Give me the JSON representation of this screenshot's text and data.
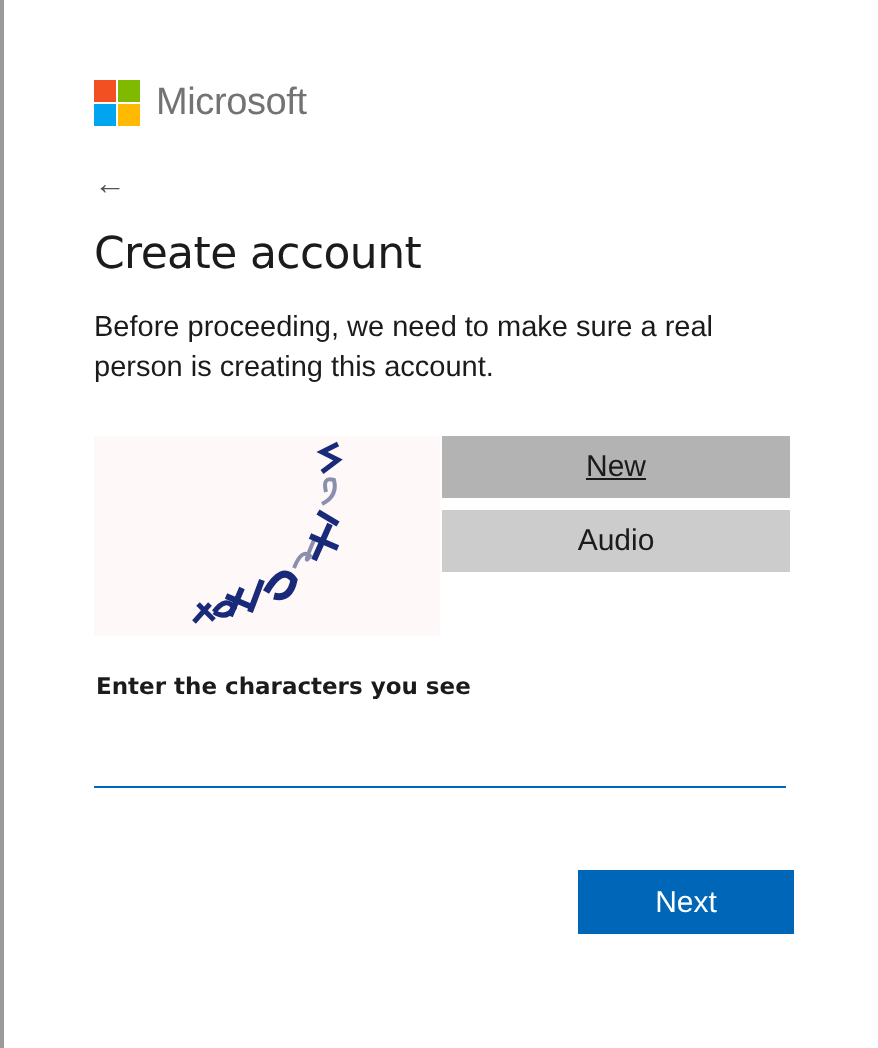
{
  "brand": {
    "name": "Microsoft"
  },
  "back": {
    "icon": "←"
  },
  "title": "Create account",
  "description": "Before proceeding, we need to make sure a real person is creating this account.",
  "captcha": {
    "kind": "picture",
    "buttons": [
      {
        "label": "New",
        "focused": true
      },
      {
        "label": "Audio",
        "focused": false
      }
    ]
  },
  "field": {
    "label": "Enter the characters you see"
  },
  "primary_button": {
    "label": "Next"
  }
}
